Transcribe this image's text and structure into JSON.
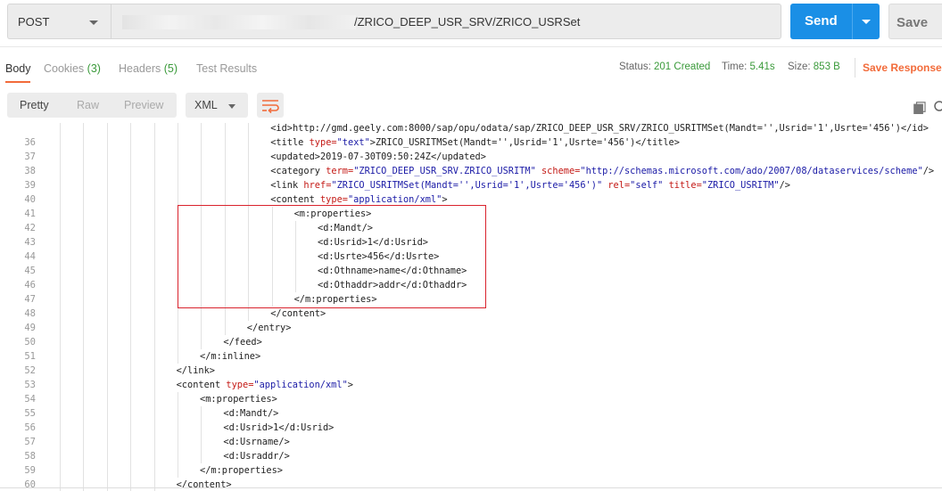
{
  "request": {
    "method": "POST",
    "url_visible": "/ZRICO_DEEP_USR_SRV/ZRICO_USRSet",
    "send_label": "Send",
    "save_label": "Save"
  },
  "tabs": [
    {
      "label": "Body",
      "count": ""
    },
    {
      "label": "Cookies",
      "count": "(3)"
    },
    {
      "label": "Headers",
      "count": "(5)"
    },
    {
      "label": "Test Results",
      "count": ""
    }
  ],
  "response_meta": {
    "status_label": "Status:",
    "status_value": "201 Created",
    "time_label": "Time:",
    "time_value": "5.41s",
    "size_label": "Size:",
    "size_value": "853 B",
    "save_response": "Save Response"
  },
  "toolbar": {
    "formats": [
      "Pretty",
      "Raw",
      "Preview"
    ],
    "active_format": "Pretty",
    "language": "XML"
  },
  "code_lines": [
    {
      "n": "",
      "indent": 10,
      "tokens": [
        [
          "n",
          "<id>http://gmd.geely.com:8000/sap/opu/odata/sap/ZRICO_DEEP_USR_SRV/ZRICO_USRITMSet(Mandt='',Usrid='1',Usrte='456')</id>"
        ]
      ]
    },
    {
      "n": "36",
      "indent": 10,
      "tokens": [
        [
          "n",
          "<title "
        ],
        [
          "a",
          "type="
        ],
        [
          "s",
          "\"text\""
        ],
        [
          "n",
          ">ZRICO_USRITMSet(Mandt='',Usrid='1',Usrte='456')</title>"
        ]
      ]
    },
    {
      "n": "37",
      "indent": 10,
      "tokens": [
        [
          "n",
          "<updated>2019-07-30T09:50:24Z</updated>"
        ]
      ]
    },
    {
      "n": "38",
      "indent": 10,
      "tokens": [
        [
          "n",
          "<category "
        ],
        [
          "a",
          "term="
        ],
        [
          "s",
          "\"ZRICO_DEEP_USR_SRV.ZRICO_USRITM\""
        ],
        [
          "n",
          " "
        ],
        [
          "a",
          "scheme="
        ],
        [
          "s",
          "\"http://schemas.microsoft.com/ado/2007/08/dataservices/scheme\""
        ],
        [
          "n",
          "/>"
        ]
      ]
    },
    {
      "n": "39",
      "indent": 10,
      "tokens": [
        [
          "n",
          "<link "
        ],
        [
          "a",
          "href="
        ],
        [
          "s",
          "\"ZRICO_USRITMSet(Mandt='',Usrid='1',Usrte='456')\""
        ],
        [
          "n",
          " "
        ],
        [
          "a",
          "rel="
        ],
        [
          "s",
          "\"self\""
        ],
        [
          "n",
          " "
        ],
        [
          "a",
          "title="
        ],
        [
          "s",
          "\"ZRICO_USRITM\""
        ],
        [
          "n",
          "/>"
        ]
      ]
    },
    {
      "n": "40",
      "indent": 10,
      "tokens": [
        [
          "n",
          "<content "
        ],
        [
          "a",
          "type="
        ],
        [
          "s",
          "\"application/xml\""
        ],
        [
          "n",
          ">"
        ]
      ]
    },
    {
      "n": "41",
      "indent": 11,
      "tokens": [
        [
          "n",
          "<m:properties>"
        ]
      ]
    },
    {
      "n": "42",
      "indent": 12,
      "tokens": [
        [
          "n",
          "<d:Mandt/>"
        ]
      ]
    },
    {
      "n": "43",
      "indent": 12,
      "tokens": [
        [
          "n",
          "<d:Usrid>1</d:Usrid>"
        ]
      ]
    },
    {
      "n": "44",
      "indent": 12,
      "tokens": [
        [
          "n",
          "<d:Usrte>456</d:Usrte>"
        ]
      ]
    },
    {
      "n": "45",
      "indent": 12,
      "tokens": [
        [
          "n",
          "<d:Othname>name</d:Othname>"
        ]
      ]
    },
    {
      "n": "46",
      "indent": 12,
      "tokens": [
        [
          "n",
          "<d:Othaddr>addr</d:Othaddr>"
        ]
      ]
    },
    {
      "n": "47",
      "indent": 11,
      "tokens": [
        [
          "n",
          "</m:properties>"
        ]
      ]
    },
    {
      "n": "48",
      "indent": 10,
      "tokens": [
        [
          "n",
          "</content>"
        ]
      ]
    },
    {
      "n": "49",
      "indent": 9,
      "tokens": [
        [
          "n",
          "</entry>"
        ]
      ]
    },
    {
      "n": "50",
      "indent": 8,
      "tokens": [
        [
          "n",
          "</feed>"
        ]
      ]
    },
    {
      "n": "51",
      "indent": 7,
      "tokens": [
        [
          "n",
          "</m:inline>"
        ]
      ]
    },
    {
      "n": "52",
      "indent": 6,
      "tokens": [
        [
          "n",
          "</link>"
        ]
      ]
    },
    {
      "n": "53",
      "indent": 6,
      "tokens": [
        [
          "n",
          "<content "
        ],
        [
          "a",
          "type="
        ],
        [
          "s",
          "\"application/xml\""
        ],
        [
          "n",
          ">"
        ]
      ]
    },
    {
      "n": "54",
      "indent": 7,
      "tokens": [
        [
          "n",
          "<m:properties>"
        ]
      ]
    },
    {
      "n": "55",
      "indent": 8,
      "tokens": [
        [
          "n",
          "<d:Mandt/>"
        ]
      ]
    },
    {
      "n": "56",
      "indent": 8,
      "tokens": [
        [
          "n",
          "<d:Usrid>1</d:Usrid>"
        ]
      ]
    },
    {
      "n": "57",
      "indent": 8,
      "tokens": [
        [
          "n",
          "<d:Usrname/>"
        ]
      ]
    },
    {
      "n": "58",
      "indent": 8,
      "tokens": [
        [
          "n",
          "<d:Usraddr/>"
        ]
      ]
    },
    {
      "n": "59",
      "indent": 7,
      "tokens": [
        [
          "n",
          "</m:properties>"
        ]
      ]
    },
    {
      "n": "60",
      "indent": 6,
      "tokens": [
        [
          "n",
          "</content>"
        ]
      ]
    }
  ],
  "icons": {
    "method_caret": "chevron-down-icon",
    "send_caret": "chevron-down-icon",
    "wrap": "wrap-lines-icon",
    "copy": "copy-icon",
    "search": "search-icon"
  },
  "colors": {
    "accent": "#f26b3a",
    "send_blue": "#1a8fe6",
    "status_green": "#3a9a3a",
    "highlight_red": "#d9232d"
  }
}
